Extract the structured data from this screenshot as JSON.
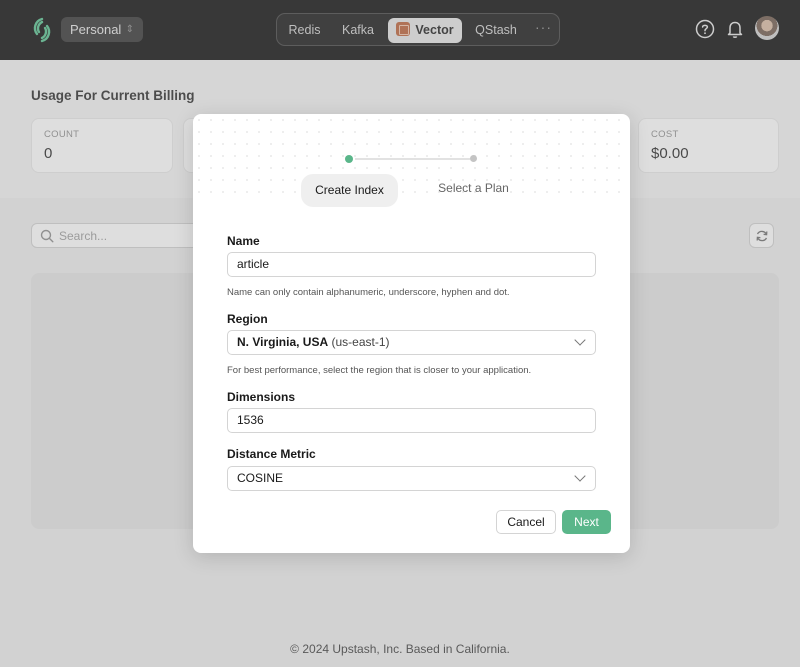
{
  "topbar": {
    "workspace_label": "Personal",
    "workspace_chevron": "⌃",
    "nav_items": [
      {
        "label": "Redis"
      },
      {
        "label": "Kafka"
      },
      {
        "label": "Vector",
        "active": true
      },
      {
        "label": "QStash"
      }
    ],
    "more_label": "···",
    "icons": [
      "help-icon",
      "bell-icon",
      "user-avatar"
    ]
  },
  "page": {
    "title": "Usage For Current Billing",
    "stats": [
      {
        "label": "COUNT",
        "value": "0"
      },
      {
        "label": "COST",
        "value": "$0.00"
      }
    ],
    "search_placeholder": "Search...",
    "footer": "© 2024 Upstash, Inc. Based in California."
  },
  "modal": {
    "steps": [
      {
        "label": "Create Index",
        "active": true
      },
      {
        "label": "Select a Plan",
        "active": false
      }
    ],
    "fields": {
      "name": {
        "label": "Name",
        "value": "article",
        "help": "Name can only contain alphanumeric, underscore, hyphen and dot."
      },
      "region": {
        "label": "Region",
        "value_main": "N. Virginia, USA",
        "value_sub": "(us-east-1)",
        "help": "For best performance, select the region that is closer to your application."
      },
      "dimensions": {
        "label": "Dimensions",
        "value": "1536"
      },
      "distance_metric": {
        "label": "Distance Metric",
        "value": "COSINE"
      }
    },
    "buttons": {
      "cancel": "Cancel",
      "next": "Next"
    }
  },
  "colors": {
    "accent_green": "#5ab68a",
    "topbar": "#000000",
    "vector_icon": "#b85a2e"
  }
}
